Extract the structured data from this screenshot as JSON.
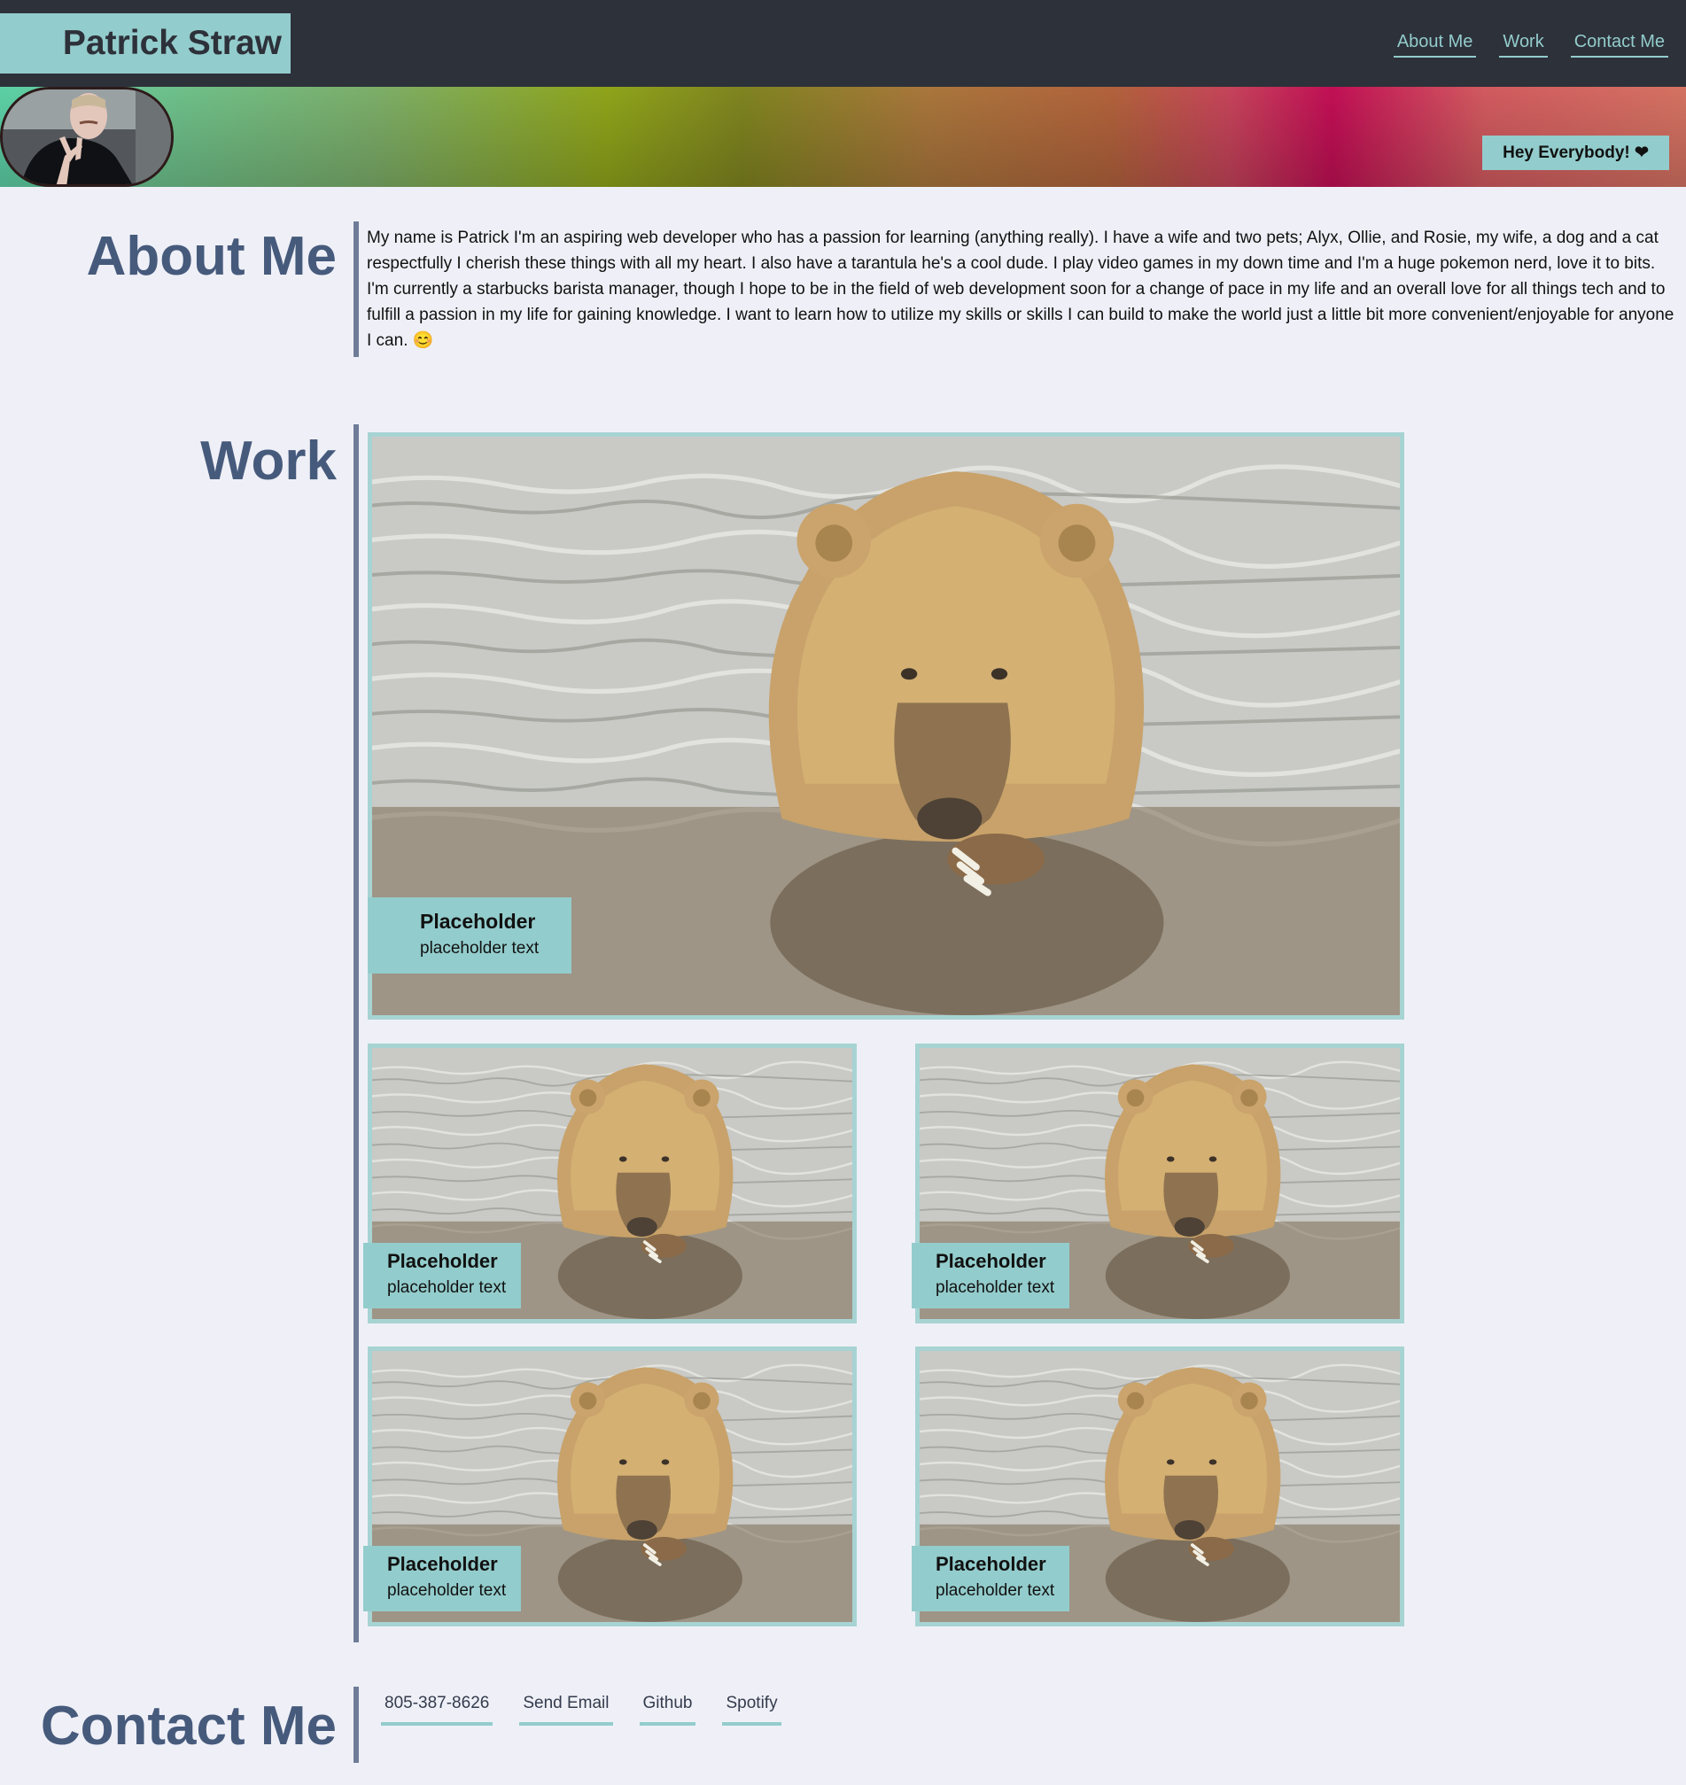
{
  "header": {
    "brand_name": "Patrick Straw",
    "nav": [
      {
        "label": "About Me"
      },
      {
        "label": "Work"
      },
      {
        "label": "Contact Me"
      }
    ]
  },
  "hero": {
    "greeting": "Hey Everybody! ❤"
  },
  "about": {
    "title": "About Me",
    "text": "My name is Patrick I'm an aspiring web developer who has a passion for learning (anything really). I have a wife and two pets; Alyx, Ollie, and Rosie, my wife, a dog and a cat respectfully I cherish these things with all my heart. I also have a tarantula he's a cool dude. I play video games in my down time and I'm a huge pokemon nerd, love it to bits. I'm currently a starbucks barista manager, though I hope to be in the field of web development soon for a change of pace in my life and an overall love for all things tech and to fulfill a passion in my life for gaining knowledge. I want to learn how to utilize my skills or skills I can build to make the world just a little bit more convenient/enjoyable for anyone I can. 😊"
  },
  "work": {
    "title": "Work",
    "projects": [
      {
        "title": "Placeholder",
        "subtitle": "placeholder text"
      },
      {
        "title": "Placeholder",
        "subtitle": "placeholder text"
      },
      {
        "title": "Placeholder",
        "subtitle": "placeholder text"
      },
      {
        "title": "Placeholder",
        "subtitle": "placeholder text"
      },
      {
        "title": "Placeholder",
        "subtitle": "placeholder text"
      }
    ]
  },
  "contact": {
    "title": "Contact Me",
    "links": [
      {
        "label": "805-387-8626"
      },
      {
        "label": "Send Email"
      },
      {
        "label": "Github"
      },
      {
        "label": "Spotify"
      }
    ]
  },
  "colors": {
    "header_bg": "#2d313a",
    "accent": "#93cccc",
    "page_bg": "#eff0f7",
    "heading": "#465a7c"
  }
}
